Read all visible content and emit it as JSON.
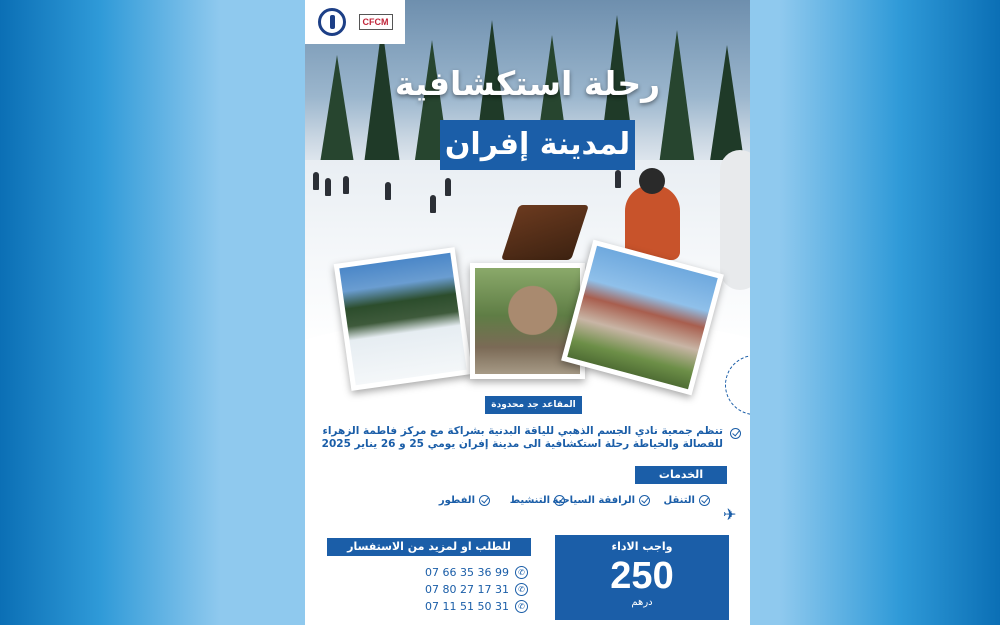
{
  "logos": {
    "left_icon": "club-emblem-icon",
    "right_text": "CFCM"
  },
  "title": {
    "line1": "رحلة استكشافية",
    "line2": "لمدينة إفران"
  },
  "seats_badge": "المقاعد جد محدودة",
  "intro_text": "تنظم جمعية نادي الجسم الذهبي للياقة البدنية بشراكة مع مركز فاطمة الزهراء للفصالة والخياطة رحلة استكشافية الى مدينة إفران يومي 25 و 26 يناير 2025",
  "services": {
    "title": "الخدمات",
    "items": [
      "التنقل",
      "الرافقة السياحية",
      "التنشيط",
      "الفطور"
    ]
  },
  "contact": {
    "title": "للطلب او لمزيد من الاستفسار",
    "phones": [
      "07 66 35 36 99",
      "07 80 27 17 31",
      "07 11 51 50 31"
    ]
  },
  "price": {
    "label": "واجب الاداء",
    "value": "250",
    "currency": "درهم"
  },
  "colors": {
    "brand_blue": "#1b5ea8",
    "background_blue": "#2f9ad8"
  }
}
